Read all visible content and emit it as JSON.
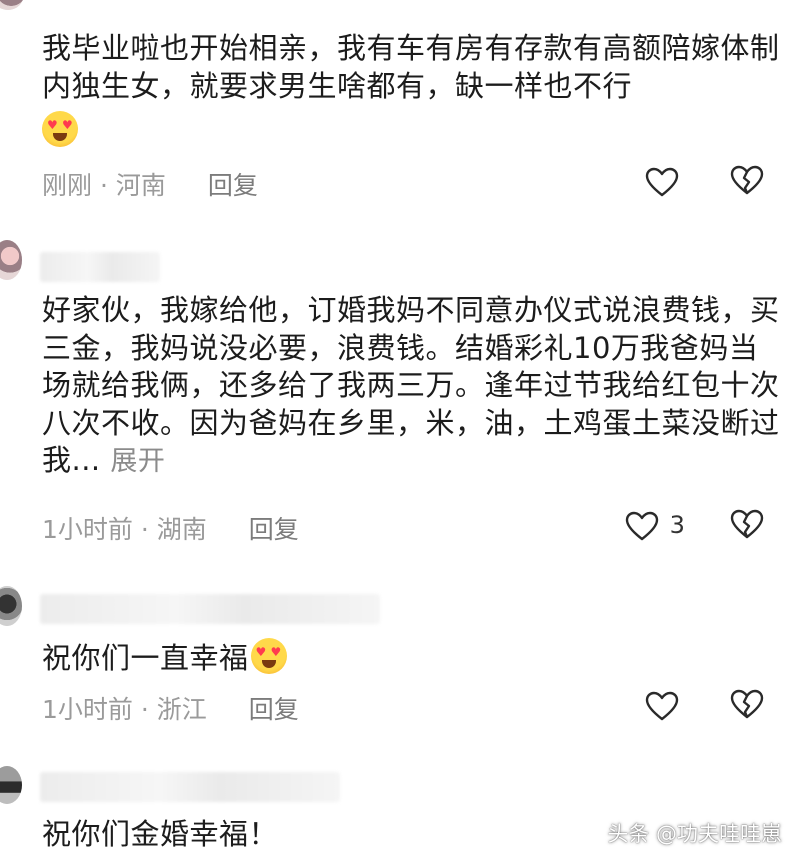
{
  "comments": [
    {
      "text": "我毕业啦也开始相亲，我有车有房有存款有高额陪嫁体制内独生女，就要求男生啥都有，缺一样也不行",
      "time": "刚刚",
      "location": "河南",
      "reply_label": "回复",
      "emoji": "heart-eyes-emoji"
    },
    {
      "text": "好家伙，我嫁给他，订婚我妈不同意办仪式说浪费钱，买三金，我妈说没必要，浪费钱。结婚彩礼10万我爸妈当场就给我俩，还多给了我两三万。逢年过节我给红包十次八次不收。因为爸妈在乡里，米，油，土鸡蛋土菜没断过我...",
      "expand_label": "展开",
      "time": "1小时前",
      "location": "湖南",
      "reply_label": "回复",
      "likes": "3"
    },
    {
      "text": "祝你们一直幸福",
      "time": "1小时前",
      "location": "浙江",
      "reply_label": "回复",
      "emoji": "heart-eyes-emoji"
    },
    {
      "text": "祝你们金婚幸福！"
    }
  ],
  "separator": " · ",
  "watermark": "头条 @功夫哇哇崽",
  "icons": [
    "heart-outline-icon",
    "broken-heart-icon"
  ]
}
